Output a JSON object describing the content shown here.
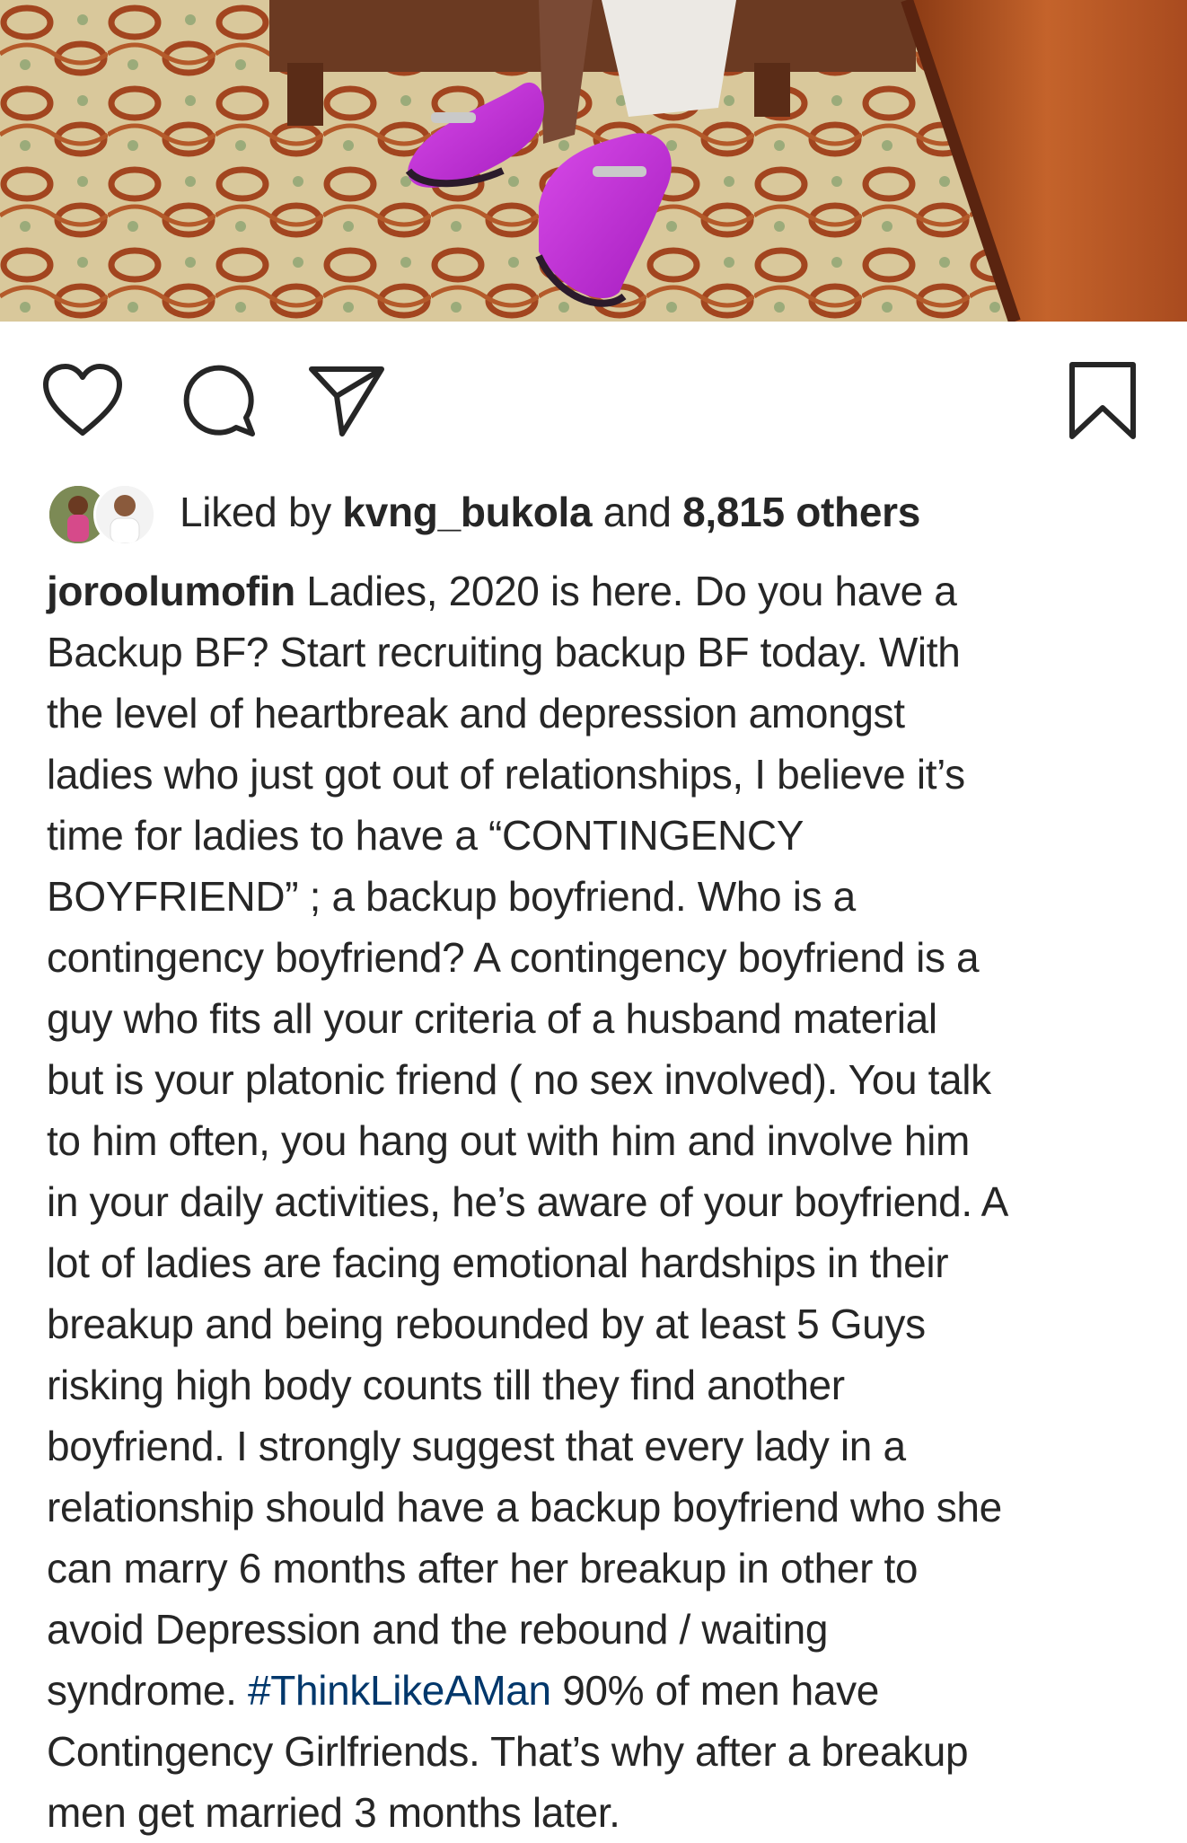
{
  "post": {
    "photo_alt": "purple-loafers-photo"
  },
  "actions": {
    "like_icon": "heart-icon",
    "comment_icon": "comment-icon",
    "share_icon": "paper-plane-icon",
    "save_icon": "bookmark-icon"
  },
  "likes": {
    "prefix": "Liked by",
    "user": "kvng_bukola",
    "connector": "and",
    "count": "8,815 others"
  },
  "caption": {
    "username": "joroolumofin",
    "line1_rest": " Ladies, 2020 is here. Do you have a",
    "lines": [
      "Backup BF? Start recruiting backup BF today. With",
      "the level of heartbreak and depression amongst",
      "ladies who just got out of relationships, I believe it’s",
      "time for ladies to have a “CONTINGENCY",
      "BOYFRIEND” ; a backup boyfriend. Who is a",
      "contingency boyfriend? A contingency boyfriend is a",
      "guy who fits all your criteria of a husband material",
      "but is your platonic friend ( no sex involved). You talk",
      "to him often, you hang out with him and involve him",
      "in your daily activities, he’s aware of your boyfriend. A",
      "lot of ladies are facing emotional hardships in their",
      "breakup and being rebounded by at least 5 Guys",
      "risking high body counts till they find another",
      "boyfriend. I strongly suggest that every lady in a",
      "relationship should have a backup boyfriend who she",
      "can marry 6 months after her breakup in other to",
      "avoid Depression and the rebound / waiting"
    ],
    "line19_prefix": "syndrome. ",
    "hashtag": "#ThinkLikeAMan",
    "line19_suffix": " 90% of men have",
    "line20": "Contingency Girlfriends. That’s why after a breakup",
    "line21": "men get married 3 months later."
  },
  "colors": {
    "text": "#262626",
    "hashtag": "#00376b",
    "shoe_purple": "#c02ad6"
  }
}
